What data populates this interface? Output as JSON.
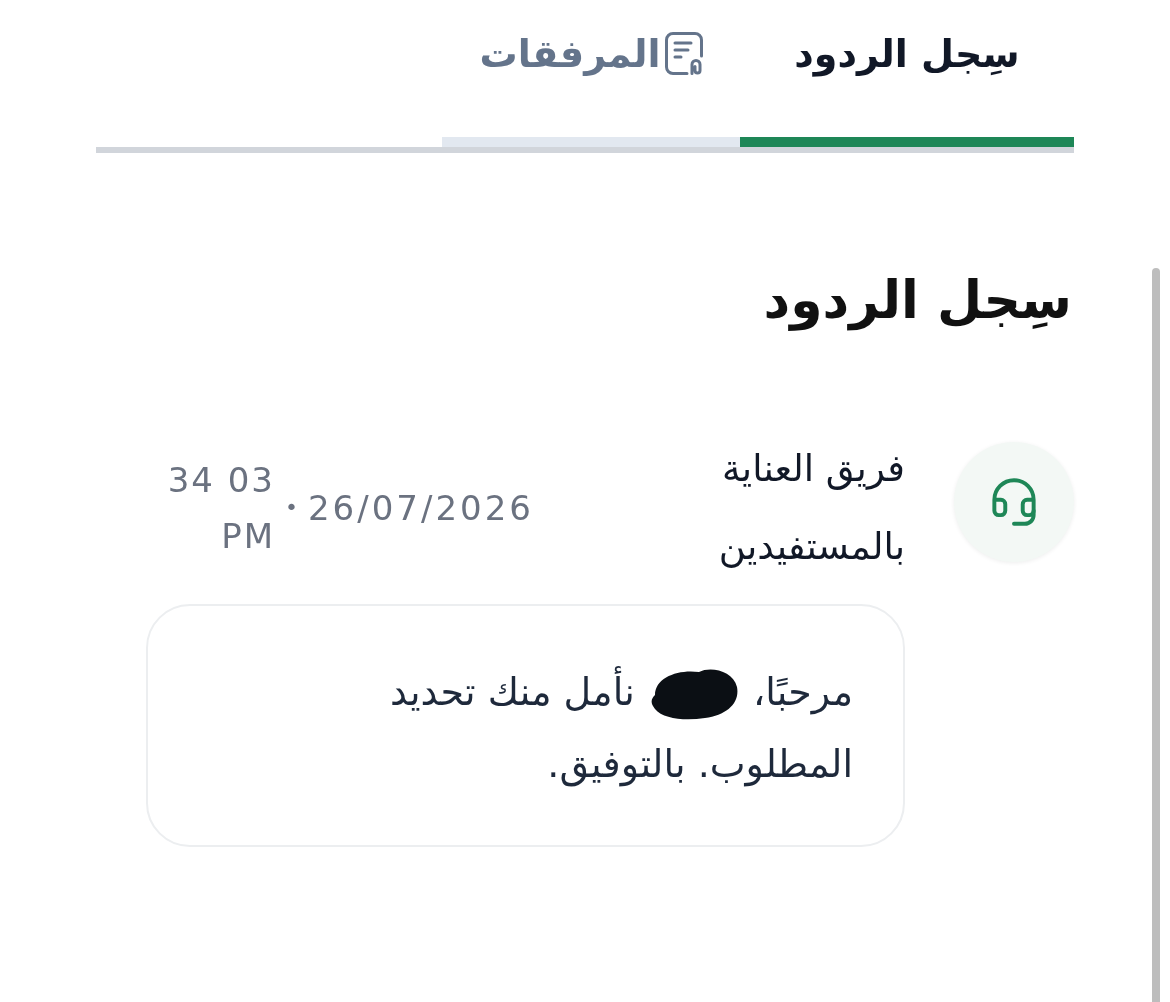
{
  "tabs": [
    {
      "label": "سِجل الردود",
      "selected": true,
      "kind": "plain"
    },
    {
      "label": "المرفقات",
      "selected": false,
      "kind": "attachment"
    }
  ],
  "heading": "سِجل الردود",
  "replies": [
    {
      "author": "فريق العناية بالمستفيدين",
      "date": "26/07/2026",
      "separator": "•",
      "time": "34 03 PM",
      "message": {
        "opening": "مرحبًا،",
        "redacted": true,
        "line_1_rest": "نأمل منك تحديد",
        "line_2": "المطلوب. بالتوفيق."
      }
    }
  ]
}
